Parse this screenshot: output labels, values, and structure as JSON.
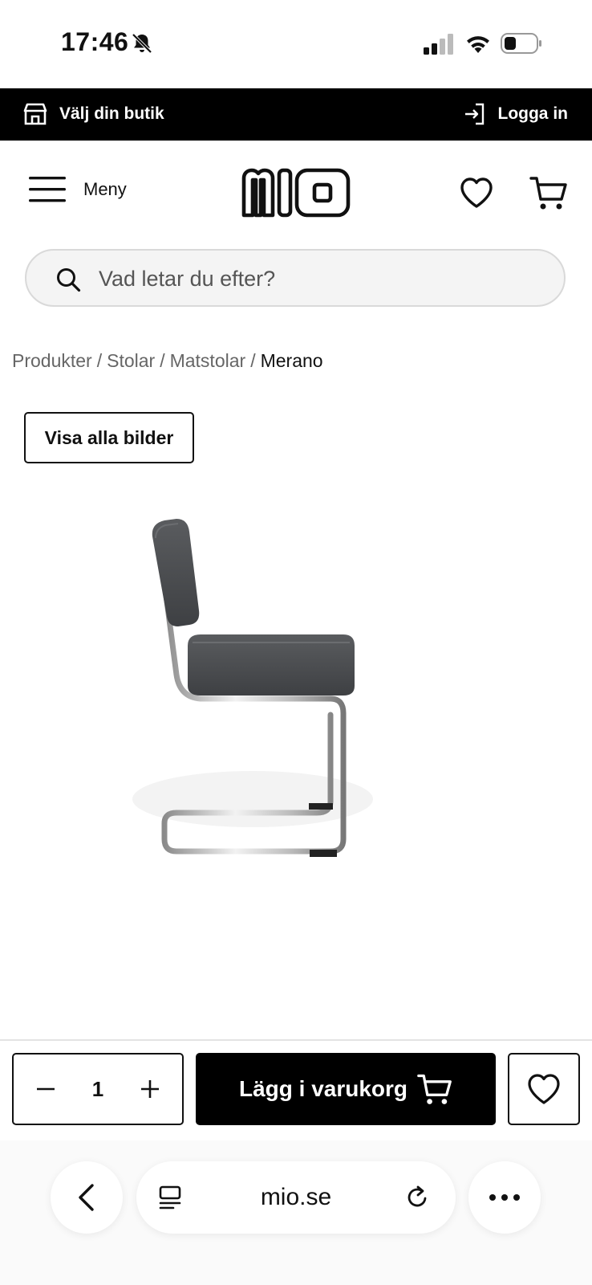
{
  "status_bar": {
    "time": "17:46",
    "icons": [
      "bell-slash-icon",
      "signal-icon",
      "wifi-icon",
      "battery-icon"
    ]
  },
  "top_bar": {
    "store_label": "Välj din butik",
    "login_label": "Logga in",
    "store_icon": "store-icon",
    "login_icon": "login-icon"
  },
  "header": {
    "menu_label": "Meny",
    "logo_text": "mio",
    "icons": [
      "hamburger-icon",
      "heart-icon",
      "cart-icon"
    ]
  },
  "search": {
    "placeholder": "Vad letar du efter?"
  },
  "breadcrumb": {
    "items": [
      "Produkter",
      "Stolar",
      "Matstolar"
    ],
    "separator": "/",
    "current": "Merano"
  },
  "product": {
    "show_all_images_label": "Visa alla bilder",
    "image_alt": "chair-image"
  },
  "purchase": {
    "quantity": "1",
    "add_to_cart_label": "Lägg i varukorg"
  },
  "browser": {
    "url": "mio.se"
  },
  "colors": {
    "primary": "#000000",
    "background": "#ffffff",
    "search_bg": "#f4f4f4"
  }
}
